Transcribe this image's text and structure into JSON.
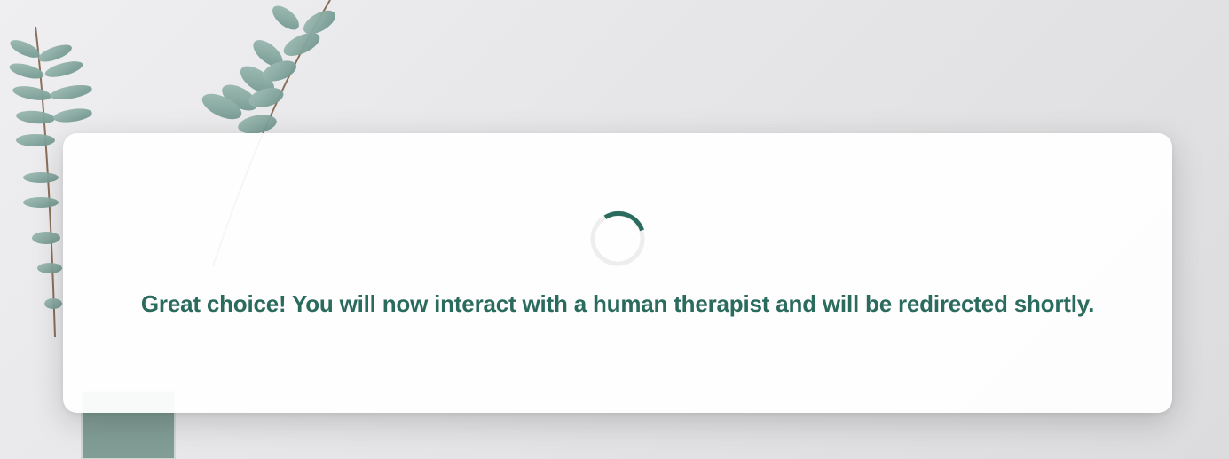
{
  "colors": {
    "accent": "#2b6b5e",
    "spinner_track": "#eeeeee",
    "leaf": "#7fa39b",
    "stem": "#8a6f5a"
  },
  "loading": {
    "icon": "loading-spinner-icon",
    "message": "Great choice! You will now interact with a human therapist and will be redirected shortly."
  },
  "background": {
    "image": "eucalyptus-plant-image"
  }
}
